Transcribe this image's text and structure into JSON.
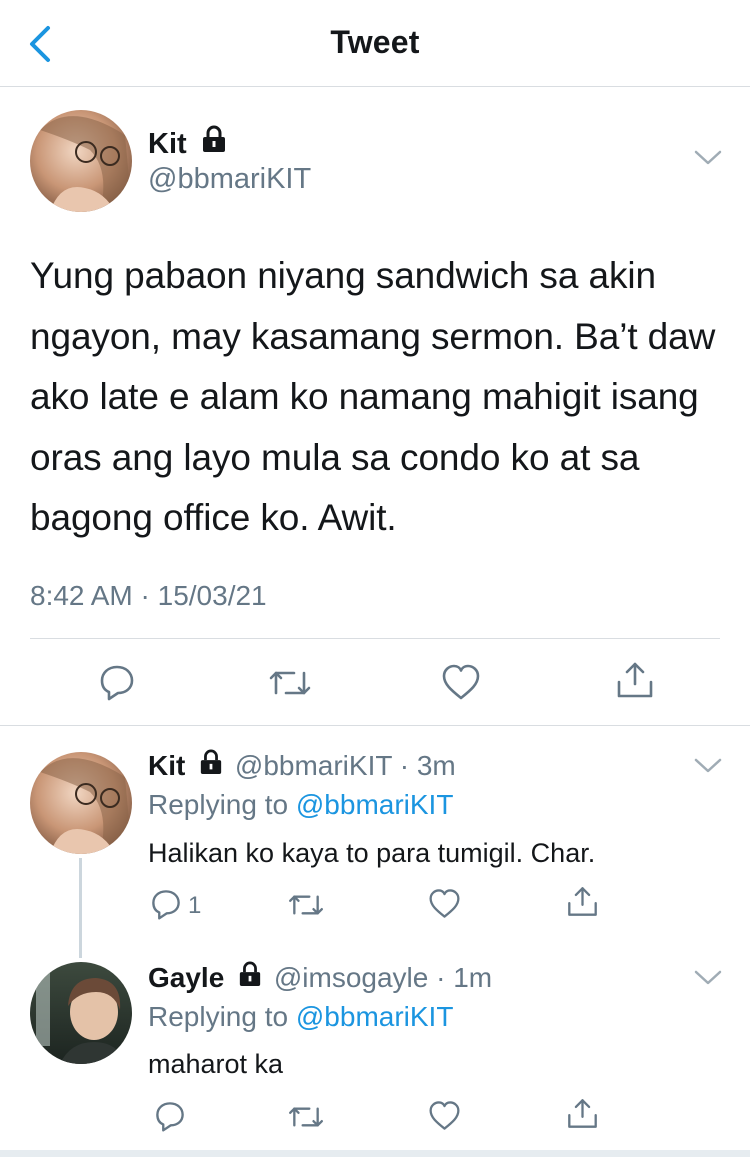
{
  "header": {
    "title": "Tweet"
  },
  "main_tweet": {
    "author_name": "Kit",
    "handle": "@bbmariKIT",
    "text": "Yung pabaon niyang sandwich sa akin ngayon, may kasamang sermon. Ba’t daw ako late e alam ko namang mahigit isang oras ang layo mula sa condo ko at sa bagong office ko. Awit.",
    "time": "8:42 AM",
    "separator": "·",
    "date": "15/03/21"
  },
  "replies": [
    {
      "author_name": "Kit",
      "handle": "@bbmariKIT",
      "dot": "·",
      "age": "3m",
      "replying_label": "Replying to",
      "replying_to": "@bbmariKIT",
      "text": "Halikan ko kaya to para tumigil. Char.",
      "reply_count": "1"
    },
    {
      "author_name": "Gayle",
      "handle": "@imsogayle",
      "dot": "·",
      "age": "1m",
      "replying_label": "Replying to",
      "replying_to": "@bbmariKIT",
      "text": "maharot ka",
      "reply_count": ""
    }
  ],
  "icons": {
    "back": "chevron-left-icon",
    "lock": "lock-icon",
    "more": "chevron-down-icon",
    "reply": "reply-bubble-icon",
    "retweet": "retweet-icon",
    "like": "heart-icon",
    "share": "share-icon"
  },
  "colors": {
    "accent": "#1b95e0",
    "text": "#14171a",
    "secondary": "#657786",
    "divider": "#d9dde1"
  }
}
